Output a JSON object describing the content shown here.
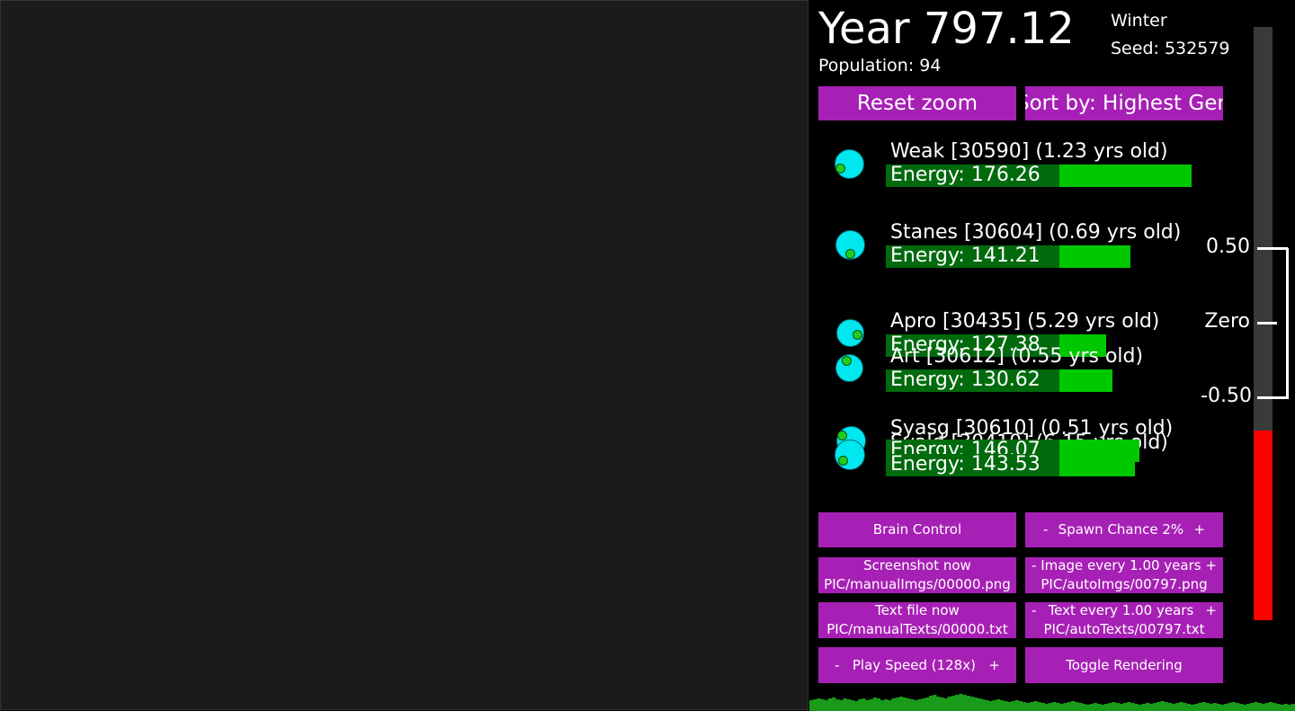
{
  "header": {
    "year": "Year 797.12",
    "population": "Population: 94",
    "season": "Winter",
    "seed": "Seed: 532579"
  },
  "top_buttons": {
    "reset_zoom": "Reset zoom",
    "sort_by": "Sort by: Highest Gen"
  },
  "creatures": [
    {
      "name": "Weak [30590] (1.23 yrs old)",
      "energy": "Energy: 176.26",
      "energy_fraction": 1.0
    },
    {
      "name": "Stanes [30604] (0.69 yrs old)",
      "energy": "Energy: 141.21",
      "energy_fraction": 0.4
    },
    {
      "name": "Apro [30435] (5.29 yrs old)",
      "energy": "Energy: 127.38",
      "energy_fraction": 0.28
    },
    {
      "name": "Art [30612] (0.55 yrs old)",
      "energy": "Energy: 130.62",
      "energy_fraction": 0.32
    },
    {
      "name": "Svald [30410] (6.15 yrs old)",
      "energy": "Energy: 146.07",
      "energy_fraction": 0.46
    },
    {
      "name": "Syasg [30610] (0.51 yrs old)",
      "energy": "Energy: 143.53",
      "energy_fraction": 0.44
    }
  ],
  "controls": {
    "brain_control": "Brain Control",
    "spawn_chance": {
      "minus": "-",
      "label": "Spawn Chance 2%",
      "plus": "+"
    },
    "screenshot": {
      "line1": "Screenshot now",
      "line2": "PIC/manualImgs/00000.png"
    },
    "image_every": {
      "minus": "-",
      "label": "Image every 1.00 years",
      "plus": "+",
      "line2": "PIC/autoImgs/00797.png"
    },
    "text_file": {
      "line1": "Text file now",
      "line2": "PIC/manualTexts/00000.txt"
    },
    "text_every": {
      "minus": "-",
      "label": "Text every 1.00 years",
      "plus": "+",
      "line2": "PIC/autoTexts/00797.txt"
    },
    "play_speed": {
      "minus": "-",
      "label": "Play Speed (128x)",
      "plus": "+"
    },
    "toggle_rendering": "Toggle Rendering"
  },
  "meter": {
    "ticks": [
      "0.50",
      "Zero",
      "-0.50"
    ],
    "value": -0.72,
    "colors": {
      "fill": "#ff0000",
      "track": "#3a3a3a"
    }
  },
  "population_graph": {
    "color": "#1a9a1a",
    "values": [
      12,
      13,
      14,
      13,
      12,
      14,
      15,
      13,
      12,
      14,
      13,
      12,
      11,
      13,
      14,
      12,
      13,
      15,
      14,
      12,
      13,
      12,
      14,
      15,
      16,
      15,
      14,
      13,
      12,
      13,
      14,
      15,
      17,
      18,
      16,
      15,
      14,
      16,
      17,
      18,
      19,
      18,
      17,
      16,
      15,
      14,
      13,
      12,
      11,
      12,
      13,
      12,
      11,
      10,
      11,
      12,
      11,
      10,
      9,
      10,
      11,
      10,
      9,
      8,
      9,
      10,
      9,
      8,
      9,
      10,
      11,
      10,
      9,
      8,
      7,
      8,
      9,
      8,
      7,
      8,
      9,
      10,
      9,
      8,
      9,
      10,
      9,
      8,
      7,
      8,
      9,
      8,
      9,
      10,
      11,
      10,
      9,
      8,
      9,
      10,
      9,
      8,
      7,
      8,
      9,
      10,
      9,
      8,
      9,
      8,
      7,
      8,
      9,
      10,
      9,
      8,
      7,
      8,
      9,
      10,
      9,
      8,
      9,
      10,
      9,
      8,
      7,
      8,
      7,
      8
    ]
  }
}
